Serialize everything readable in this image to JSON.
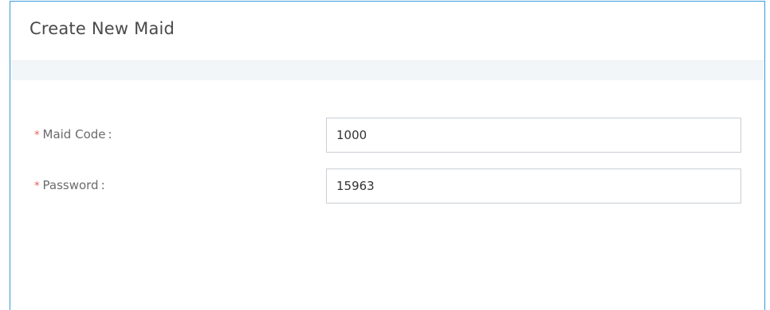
{
  "dialog": {
    "title": "Create New Maid"
  },
  "form": {
    "maid_code": {
      "required_mark": "*",
      "label": "Maid Code",
      "colon": ":",
      "value": "1000"
    },
    "password": {
      "required_mark": "*",
      "label": "Password",
      "colon": ":",
      "value": "15963"
    }
  },
  "colors": {
    "accent_border": "#3a9bdc",
    "required": "#e85b5b",
    "header_band": "#f3f6f9"
  }
}
